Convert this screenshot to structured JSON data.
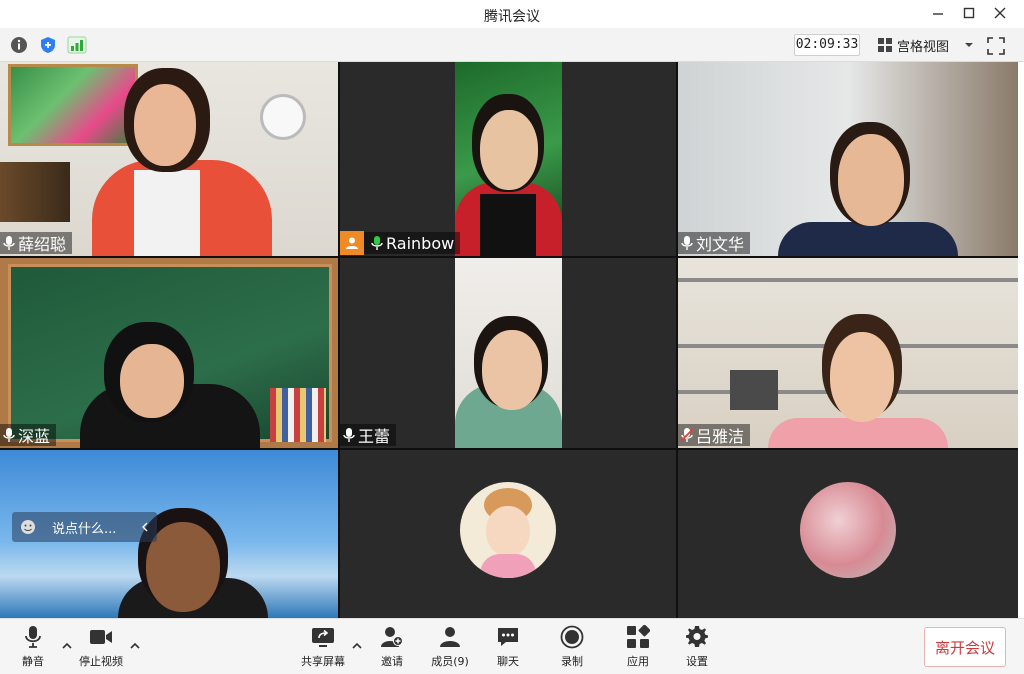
{
  "window": {
    "title": "腾讯会议"
  },
  "topbar": {
    "timer": "02:09:33",
    "view_label": "宫格视图"
  },
  "participants": [
    {
      "name": "薛绍聪"
    },
    {
      "name": "Rainbow"
    },
    {
      "name": "刘文华"
    },
    {
      "name": "深蓝"
    },
    {
      "name": "王蕾"
    },
    {
      "name": "吕雅洁"
    }
  ],
  "chat_input": {
    "placeholder": "说点什么..."
  },
  "toolbar": {
    "mute": "静音",
    "stop_video": "停止视频",
    "share_screen": "共享屏幕",
    "invite": "邀请",
    "members": "成员(9)",
    "chat": "聊天",
    "record": "录制",
    "apps": "应用",
    "settings": "设置",
    "leave": "离开会议"
  },
  "colors": {
    "leave_text": "#d0393b",
    "mic_active": "#2ecc40",
    "mic_muted": "#e04040",
    "host_badge": "#f08a24"
  }
}
